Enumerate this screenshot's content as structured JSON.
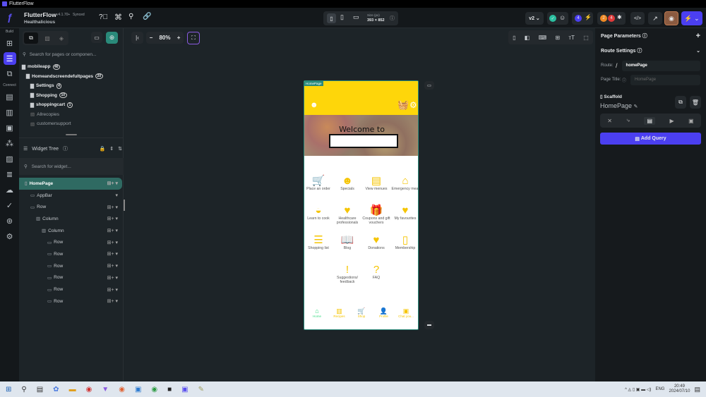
{
  "window": {
    "title": "FlutterFlow"
  },
  "header": {
    "app": "FlutterFlow",
    "version": "v4.1.70+",
    "sync": "Synced",
    "project": "Healthalicious",
    "size_label": "Size (px)",
    "size_value": "393 × 852",
    "branch": "v2",
    "badge_tests": "4",
    "badge_warn": "2",
    "badge_err": "4"
  },
  "rail": {
    "build": "Build",
    "connect": "Connect"
  },
  "pages": {
    "search_placeholder": "Search for pages or componen...",
    "items": [
      {
        "label": "mobileapp",
        "count": "46",
        "level": 0,
        "type": "folder-open"
      },
      {
        "label": "Homeandscreendefultpages",
        "count": "20",
        "level": 1,
        "type": "folder-open"
      },
      {
        "label": "Settings",
        "count": "4",
        "level": 2,
        "type": "folder"
      },
      {
        "label": "Shopping",
        "count": "10",
        "level": 2,
        "type": "folder"
      },
      {
        "label": "shoppingcart",
        "count": "1",
        "level": 2,
        "type": "folder"
      },
      {
        "label": "Allrecopies",
        "count": "",
        "level": 2,
        "type": "page"
      },
      {
        "label": "customersupport",
        "count": "",
        "level": 2,
        "type": "page"
      }
    ]
  },
  "widget_tree": {
    "title": "Widget Tree",
    "search_placeholder": "Search for widget...",
    "items": [
      {
        "label": "HomePage",
        "level": 0
      },
      {
        "label": "AppBar",
        "level": 1
      },
      {
        "label": "Row",
        "level": 1
      },
      {
        "label": "Column",
        "level": 2
      },
      {
        "label": "Column",
        "level": 3
      },
      {
        "label": "Row",
        "level": 4
      },
      {
        "label": "Row",
        "level": 4
      },
      {
        "label": "Row",
        "level": 4
      },
      {
        "label": "Row",
        "level": 4
      },
      {
        "label": "Row",
        "level": 4
      },
      {
        "label": "Row",
        "level": 4
      }
    ]
  },
  "canvas": {
    "zoom": "80%",
    "page_tag": "HomePage",
    "welcome": "Welcome to",
    "grid": [
      {
        "label": "Place an order",
        "icon": "🛒"
      },
      {
        "label": "Specials",
        "icon": "☻"
      },
      {
        "label": "View menues",
        "icon": "▤"
      },
      {
        "label": "Emergency meal",
        "icon": "⌂"
      },
      {
        "label": "Learn to cook",
        "icon": "◒"
      },
      {
        "label": "Healthcare professionals",
        "icon": "♥"
      },
      {
        "label": "Coupons and gift vouchers",
        "icon": "🎁"
      },
      {
        "label": "My favourites",
        "icon": "♥"
      },
      {
        "label": "Shopping list",
        "icon": "☰"
      },
      {
        "label": "Blog",
        "icon": "📖"
      },
      {
        "label": "Donations",
        "icon": "♥"
      },
      {
        "label": "Membership",
        "icon": "▯"
      },
      {
        "label": "Suggestions/ feedback",
        "icon": "!"
      },
      {
        "label": "FAQ",
        "icon": "?"
      }
    ],
    "nav": [
      {
        "label": "Home",
        "color": "#3ddc84"
      },
      {
        "label": "Recipes",
        "color": "#f5c400"
      },
      {
        "label": "Shop",
        "color": "#f5c400"
      },
      {
        "label": "Profile",
        "color": "#f5c400"
      },
      {
        "label": "Chat you...",
        "color": "#f5c400"
      }
    ]
  },
  "right": {
    "page_params": "Page Parameters",
    "route_settings": "Route Settings",
    "route_label": "Route:",
    "route_slash": "/",
    "route_value": "homePage",
    "page_title_label": "Page Title:",
    "page_title_placeholder": "HomePage",
    "scaffold": "Scaffold",
    "widget_name": "HomePage",
    "add_query": "Add Query"
  },
  "taskbar": {
    "time": "20:49",
    "date": "2024/07/10",
    "lang": "ENG"
  }
}
